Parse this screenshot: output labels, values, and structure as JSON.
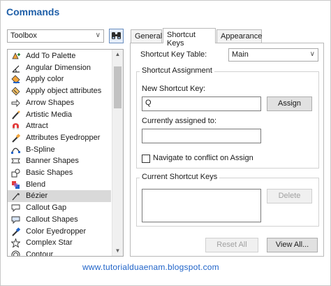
{
  "window": {
    "title": "Commands"
  },
  "category_select": {
    "value": "Toolbox"
  },
  "command_list": {
    "items": [
      {
        "label": "Add To Palette",
        "icon": "add-to-palette-icon"
      },
      {
        "label": "Angular Dimension",
        "icon": "angular-dimension-icon"
      },
      {
        "label": "Apply color",
        "icon": "apply-color-icon"
      },
      {
        "label": "Apply object attributes",
        "icon": "apply-attributes-icon"
      },
      {
        "label": "Arrow Shapes",
        "icon": "arrow-shapes-icon"
      },
      {
        "label": "Artistic Media",
        "icon": "artistic-media-icon"
      },
      {
        "label": "Attract",
        "icon": "attract-icon"
      },
      {
        "label": "Attributes Eyedropper",
        "icon": "attributes-eyedropper-icon"
      },
      {
        "label": "B-Spline",
        "icon": "b-spline-icon"
      },
      {
        "label": "Banner Shapes",
        "icon": "banner-shapes-icon"
      },
      {
        "label": "Basic Shapes",
        "icon": "basic-shapes-icon"
      },
      {
        "label": "Blend",
        "icon": "blend-icon"
      },
      {
        "label": "Bézier",
        "icon": "bezier-icon",
        "selected": true
      },
      {
        "label": "Callout Gap",
        "icon": "callout-gap-icon"
      },
      {
        "label": "Callout Shapes",
        "icon": "callout-shapes-icon"
      },
      {
        "label": "Color Eyedropper",
        "icon": "color-eyedropper-icon"
      },
      {
        "label": "Complex Star",
        "icon": "complex-star-icon"
      },
      {
        "label": "Contour",
        "icon": "contour-icon"
      }
    ]
  },
  "tabs": [
    {
      "label": "General",
      "active": false
    },
    {
      "label": "Shortcut Keys",
      "active": true
    },
    {
      "label": "Appearance",
      "active": false
    }
  ],
  "shortcut_keys": {
    "table_label": "Shortcut Key Table:",
    "table_value": "Main",
    "assignment_group": "Shortcut Assignment",
    "new_key_label": "New Shortcut Key:",
    "new_key_value": "Q",
    "assign_button": "Assign",
    "currently_assigned_label": "Currently assigned to:",
    "currently_assigned_value": "",
    "navigate_checkbox_label": "Navigate to conflict on Assign",
    "navigate_checked": false,
    "current_keys_group": "Current Shortcut Keys",
    "delete_button": "Delete",
    "reset_all_button": "Reset All",
    "view_all_button": "View All..."
  },
  "footer": {
    "watermark": "www.tutorialduaenam.blogspot.com"
  },
  "colors": {
    "title": "#1f5fa8",
    "watermark": "#1f63c8",
    "selection": "#d9d9d9"
  }
}
